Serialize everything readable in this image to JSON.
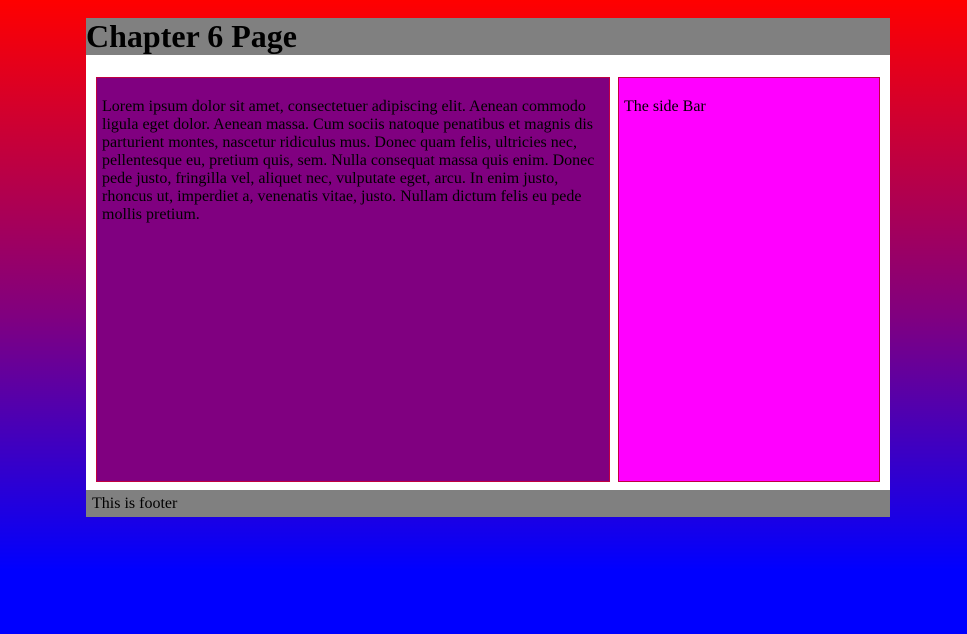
{
  "header": {
    "title": "Chapter 6 Page"
  },
  "content": {
    "paragraph": "Lorem ipsum dolor sit amet, consectetuer adipiscing elit. Aenean commodo ligula eget dolor. Aenean massa. Cum sociis natoque penatibus et magnis dis parturient montes, nascetur ridiculus mus. Donec quam felis, ultricies nec, pellentesque eu, pretium quis, sem. Nulla consequat massa quis enim. Donec pede justo, fringilla vel, aliquet nec, vulputate eget, arcu. In enim justo, rhoncus ut, imperdiet a, venenatis vitae, justo. Nullam dictum felis eu pede mollis pretium."
  },
  "sidebar": {
    "text": "The side Bar"
  },
  "footer": {
    "text": "This is footer"
  },
  "colors": {
    "background_top": "#ff0000",
    "background_bottom": "#0000ff",
    "header_bg": "#808080",
    "content_bg": "#800080",
    "sidebar_bg": "#ff00ff",
    "footer_bg": "#808080"
  }
}
